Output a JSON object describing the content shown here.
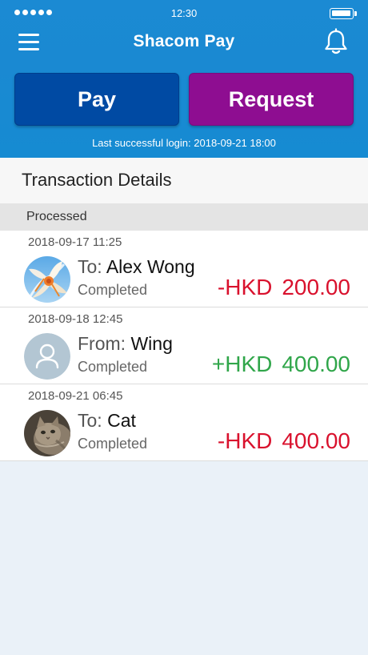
{
  "status_bar": {
    "time": "12:30"
  },
  "header": {
    "title": "Shacom Pay",
    "menu_icon": "hamburger-menu-icon",
    "bell_icon": "bell-icon",
    "pay_label": "Pay",
    "request_label": "Request",
    "last_login": "Last successful login: 2018-09-21  18:00",
    "colors": {
      "header_bg": "#1a89d2",
      "pay_bg": "#004aa3",
      "request_bg": "#8e0d91"
    }
  },
  "section": {
    "title": "Transaction Details",
    "group_label": "Processed"
  },
  "transactions": [
    {
      "datetime": "2018-09-17 11:25",
      "prefix": "To:",
      "name": "Alex Wong",
      "status": "Completed",
      "sign": "-",
      "currency": "HKD",
      "amount": "200.00",
      "avatar": "flower-photo-avatar"
    },
    {
      "datetime": "2018-09-18 12:45",
      "prefix": "From:",
      "name": "Wing",
      "status": "Completed",
      "sign": "+",
      "currency": "HKD",
      "amount": "400.00",
      "avatar": "default-user-avatar-icon"
    },
    {
      "datetime": "2018-09-21 06:45",
      "prefix": "To:",
      "name": "Cat",
      "status": "Completed",
      "sign": "-",
      "currency": "HKD",
      "amount": "400.00",
      "avatar": "cat-photo-avatar"
    }
  ],
  "colors": {
    "negative": "#d9112d",
    "positive": "#30a64a"
  }
}
